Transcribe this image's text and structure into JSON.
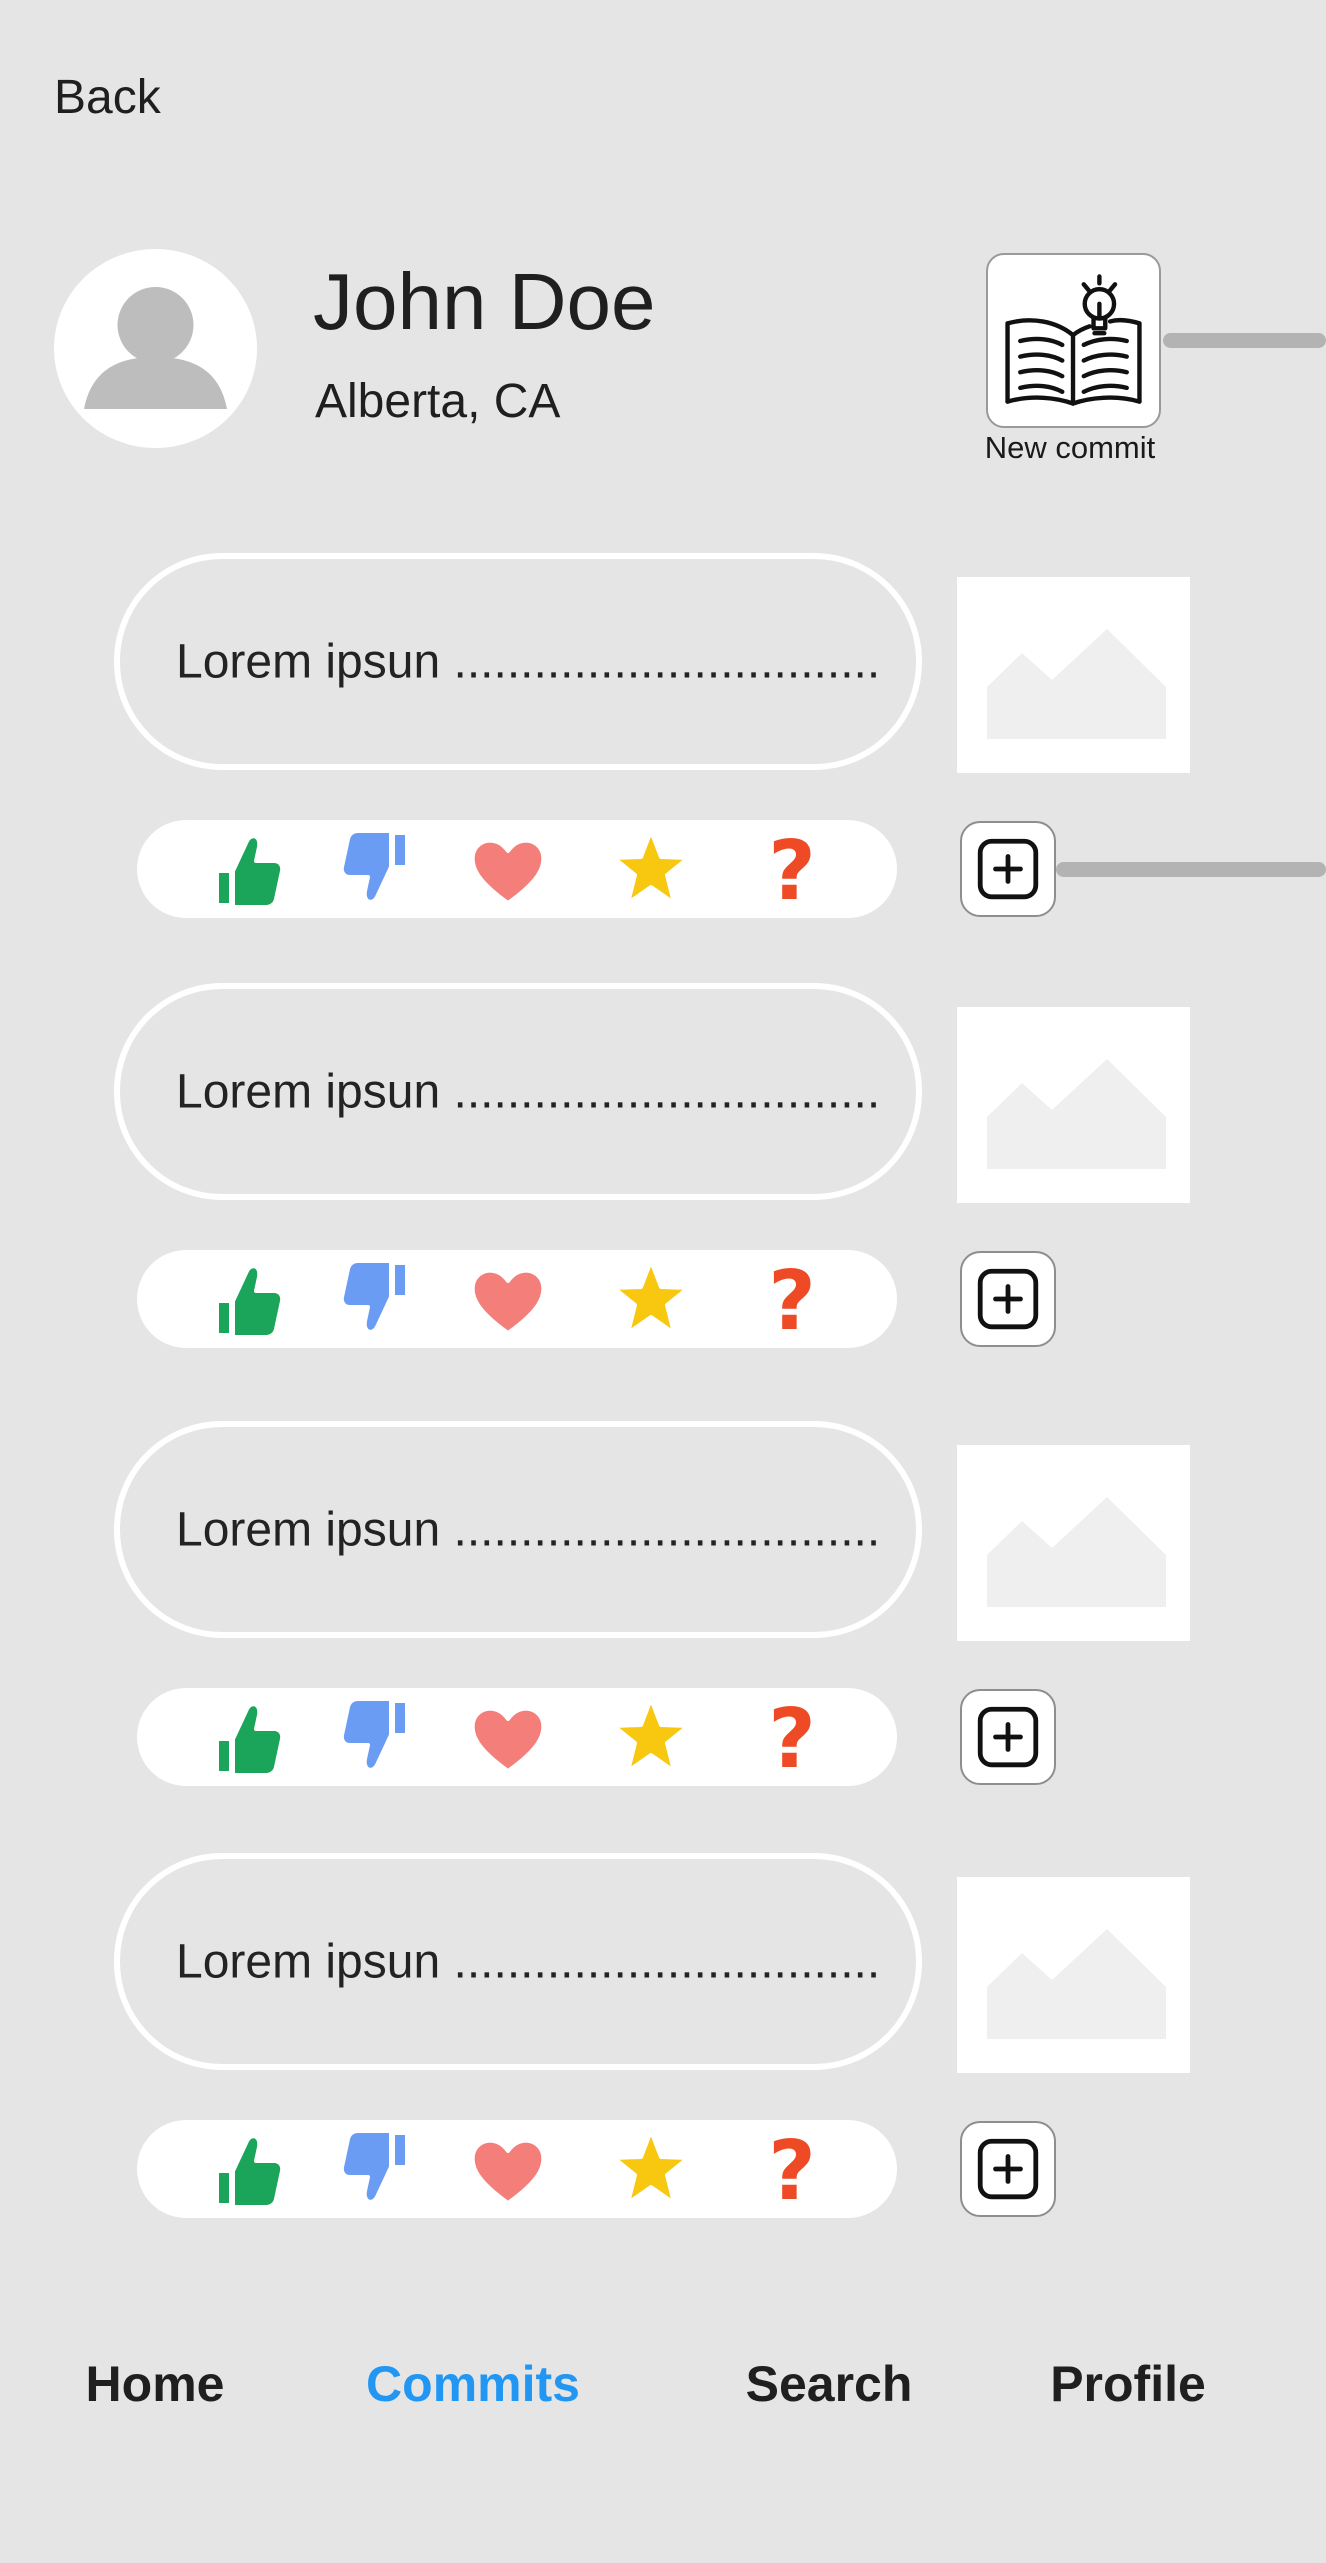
{
  "header": {
    "back_label": "Back"
  },
  "profile": {
    "name": "John Doe",
    "location": "Alberta, CA"
  },
  "new_commit": {
    "label": "New commit",
    "icon": "open-book-lightbulb-icon"
  },
  "commits": [
    {
      "text": "Lorem ipsun ................................"
    },
    {
      "text": "Lorem ipsun ................................"
    },
    {
      "text": "Lorem ipsun ................................"
    },
    {
      "text": "Lorem ipsun ................................"
    }
  ],
  "reactions": [
    {
      "name": "thumbs-up-icon",
      "color": "#1aa55a"
    },
    {
      "name": "thumbs-down-icon",
      "color": "#6b9cf3"
    },
    {
      "name": "heart-icon",
      "color": "#f47f7a"
    },
    {
      "name": "star-icon",
      "color": "#f8c70f"
    },
    {
      "name": "question-icon",
      "color": "#ee4a25"
    }
  ],
  "nav": {
    "items": [
      {
        "label": "Home",
        "active": false
      },
      {
        "label": "Commits",
        "active": true
      },
      {
        "label": "Search",
        "active": false
      },
      {
        "label": "Profile",
        "active": false
      }
    ],
    "active_color": "#2196f3"
  }
}
